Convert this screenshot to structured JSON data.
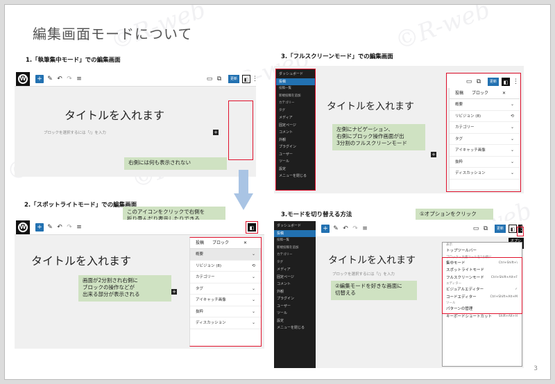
{
  "page": {
    "title": "編集画面モードについて",
    "page_number": "3",
    "watermark": "©R-web"
  },
  "section1": {
    "heading": "1.「執筆集中モード」での編集画面",
    "update_label": "更新",
    "post_title": "タイトルを入れます",
    "hint": "ブロックを選択するには「/」を入力",
    "callout": "右側には何も表示されない"
  },
  "section2": {
    "heading": "2.「スポットライトモード」での編集画面",
    "callout_top": [
      "このアイコンをクリックで右側を",
      "折り畳んだり表示したりできる"
    ],
    "post_title": "タイトルを入れます",
    "callout_left": [
      "画面が2分割され右側に",
      "ブロックの操作などが",
      "出来る部分が表示される"
    ],
    "sidebar_tabs": [
      "投稿",
      "ブロック"
    ],
    "sidebar_rows": [
      "概要",
      "リビジョン (8)",
      "カテゴリー",
      "タグ",
      "アイキャッチ画像",
      "抜粋",
      "ディスカッション"
    ]
  },
  "section3": {
    "heading": "3.「フルスクリーンモード」での編集画面",
    "nav_items": [
      {
        "label": "ダッシュボード",
        "type": "top"
      },
      {
        "label": "投稿",
        "type": "hd"
      },
      {
        "label": "投稿一覧",
        "type": "sub"
      },
      {
        "label": "新規投稿を追加",
        "type": "sub"
      },
      {
        "label": "カテゴリー",
        "type": "sub"
      },
      {
        "label": "タグ",
        "type": "sub"
      },
      {
        "label": "メディア",
        "type": "item"
      },
      {
        "label": "固定ページ",
        "type": "item"
      },
      {
        "label": "コメント",
        "type": "item"
      },
      {
        "label": "外観",
        "type": "item"
      },
      {
        "label": "プラグイン",
        "type": "item"
      },
      {
        "label": "ユーザー",
        "type": "item"
      },
      {
        "label": "ツール",
        "type": "item"
      },
      {
        "label": "設定",
        "type": "item"
      },
      {
        "label": "メニューを閉じる",
        "type": "item"
      }
    ],
    "post_title": "タイトルを入れます",
    "callout": [
      "左側にナビゲーション、",
      "右側にブロック操作画面が出",
      "3分割のフルスクリーンモード"
    ],
    "update_label": "更新",
    "sidebar_tabs": [
      "投稿",
      "ブロック"
    ],
    "sidebar_rows": [
      "概要",
      "リビジョン (8)",
      "カテゴリー",
      "タグ",
      "アイキャッチ画像",
      "抜粋",
      "ディスカッション"
    ]
  },
  "section4": {
    "heading": "3.モードを切り替える方法",
    "callout_option": "①オプションをクリック",
    "tooltip": "オプション",
    "post_title": "タイトルを入れます",
    "hint": "ブロックを選択するには「/」を入力",
    "callout_switch": [
      "②編集モードを好きな画面に",
      "切替える"
    ],
    "nav_items": [
      "ダッシュボード",
      "投稿",
      "投稿一覧",
      "新規投稿を追加",
      "カテゴリー",
      "タグ",
      "メディア",
      "固定ページ",
      "コメント",
      "外観",
      "プラグイン",
      "ユーザー",
      "ツール",
      "設定",
      "メニューを閉じる"
    ],
    "menu": [
      {
        "label": "表示",
        "key": "",
        "small": true
      },
      {
        "label": "トップツールバー",
        "key": "",
        "small": false
      },
      {
        "label": "ブロック・文書ツールを1か所に",
        "key": "",
        "small": true
      },
      {
        "label": "集中モード",
        "key": "Ctrl+Shift+\\",
        "small": false
      },
      {
        "label": "スポットライトモード",
        "key": "",
        "small": false
      },
      {
        "label": "フルスクリーンモード",
        "key": "Ctrl+Shift+Alt+F",
        "small": false
      },
      {
        "label": "エディター",
        "key": "",
        "small": true
      },
      {
        "label": "ビジュアルエディター",
        "key": "✓",
        "small": false
      },
      {
        "label": "コードエディター",
        "key": "Ctrl+Shift+Alt+M",
        "small": false
      },
      {
        "label": "ツール",
        "key": "",
        "small": true
      },
      {
        "label": "パターンの管理",
        "key": "",
        "small": false
      },
      {
        "label": "キーボードショートカット",
        "key": "Shift+Alt+H",
        "small": false
      }
    ]
  },
  "colors": {
    "accent": "#2271b1",
    "callout": "#cfe2c2",
    "highlight": "#e0102b",
    "arrow": "#a9c4e4"
  }
}
